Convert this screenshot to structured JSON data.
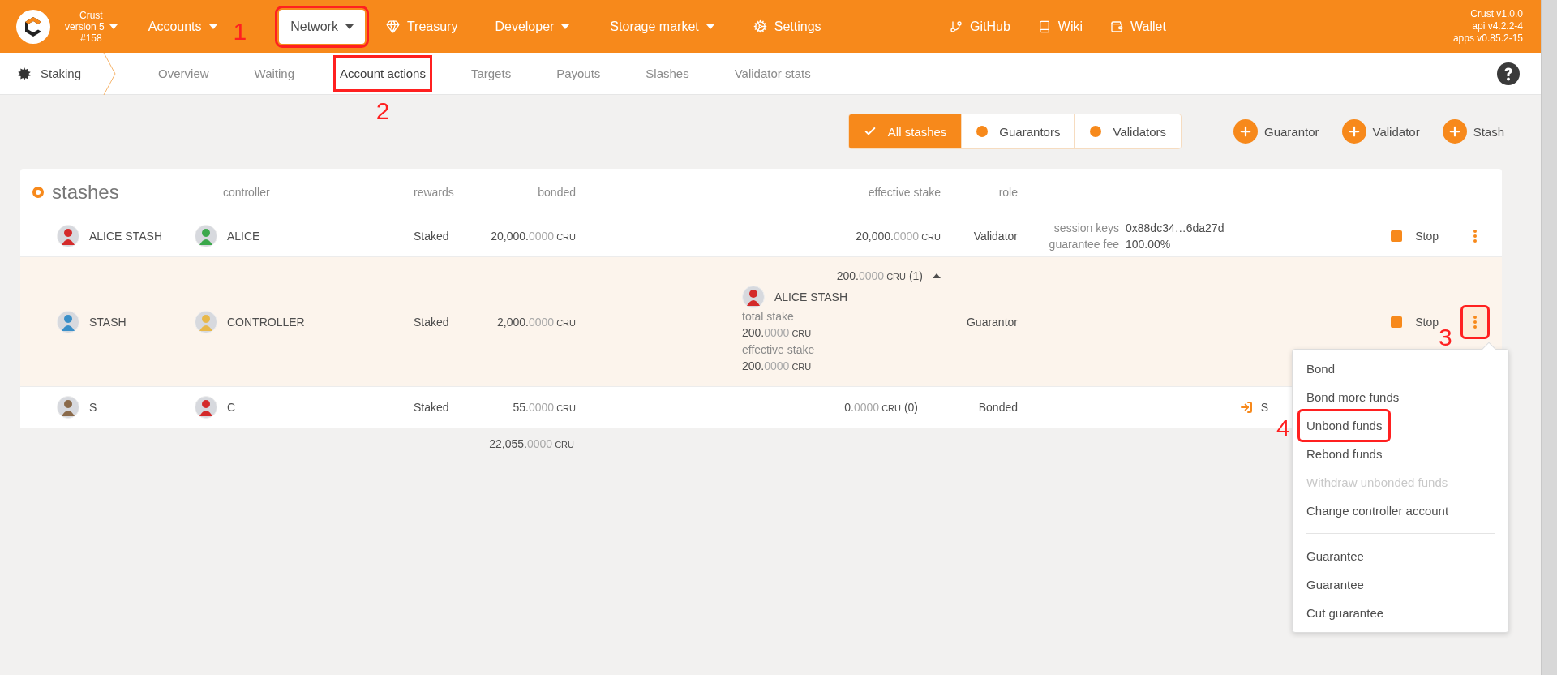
{
  "header": {
    "logo": {
      "name": "Crust",
      "version": "version 5",
      "build": "#158"
    },
    "nav": [
      {
        "label": "Accounts",
        "kind": "menu",
        "selected": false
      },
      {
        "label": "Network",
        "kind": "menu",
        "selected": true,
        "annotation": "1"
      },
      {
        "label": "Treasury",
        "kind": "link",
        "selected": false
      },
      {
        "label": "Developer",
        "kind": "menu",
        "selected": false
      },
      {
        "label": "Storage market",
        "kind": "menu",
        "selected": false
      },
      {
        "label": "Settings",
        "kind": "link",
        "selected": false
      }
    ],
    "links": [
      "GitHub",
      "Wiki",
      "Wallet"
    ],
    "versions": [
      "Crust v1.0.0",
      "api v4.2.2-4",
      "apps v0.85.2-15"
    ]
  },
  "subnav": {
    "section": "Staking",
    "tabs": [
      {
        "label": "Overview",
        "selected": false
      },
      {
        "label": "Waiting",
        "selected": false
      },
      {
        "label": "Account actions",
        "selected": true,
        "annotation": "2"
      },
      {
        "label": "Targets",
        "selected": false
      },
      {
        "label": "Payouts",
        "selected": false
      },
      {
        "label": "Slashes",
        "selected": false
      },
      {
        "label": "Validator stats",
        "selected": false
      }
    ]
  },
  "filters": [
    {
      "label": "All stashes",
      "selected": true
    },
    {
      "label": "Guarantors",
      "selected": false
    },
    {
      "label": "Validators",
      "selected": false
    }
  ],
  "add_buttons": [
    "Guarantor",
    "Validator",
    "Stash"
  ],
  "table": {
    "title": "stashes",
    "columns": [
      "controller",
      "rewards",
      "bonded",
      "effective stake",
      "role"
    ],
    "rows": [
      {
        "stash": {
          "name": "ALICE STASH",
          "color": "#d42a2a"
        },
        "controller": {
          "name": "ALICE",
          "color": "#3aa84a"
        },
        "rewards": "Staked",
        "bonded": {
          "whole": "20,000.",
          "fraction": "0000",
          "unit": "CRU"
        },
        "effective": {
          "amount": {
            "whole": "20,000.",
            "fraction": "0000",
            "unit": "CRU"
          }
        },
        "role": "Validator",
        "details": [
          {
            "label": "session keys",
            "value": "0x88dc34…6da27d"
          },
          {
            "label": "guarantee fee",
            "value": "100.00%"
          }
        ],
        "actions": [
          {
            "kind": "stop",
            "label": "Stop"
          },
          {
            "kind": "more",
            "menu_open": false
          }
        ]
      },
      {
        "stash": {
          "name": "STASH",
          "color": "#3a8fc8"
        },
        "controller": {
          "name": "CONTROLLER",
          "color": "#e8b84a"
        },
        "rewards": "Staked",
        "bonded": {
          "whole": "2,000.",
          "fraction": "0000",
          "unit": "CRU"
        },
        "effective": {
          "amount": {
            "whole": "200.",
            "fraction": "0000",
            "unit": "CRU"
          },
          "count": "(1)",
          "expanded": true,
          "nominees": [
            {
              "name": "ALICE STASH",
              "color": "#d42a2a",
              "total_label": "total stake",
              "total": {
                "whole": "200.",
                "fraction": "0000",
                "unit": "CRU"
              },
              "effective_label": "effective stake",
              "effective": {
                "whole": "200.",
                "fraction": "0000",
                "unit": "CRU"
              }
            }
          ]
        },
        "role": "Guarantor",
        "highlighted": true,
        "actions": [
          {
            "kind": "stop",
            "label": "Stop"
          },
          {
            "kind": "more",
            "menu_open": true,
            "annotation": "3"
          }
        ]
      },
      {
        "stash": {
          "name": "S",
          "color": "#8a6a4a"
        },
        "controller": {
          "name": "C",
          "color": "#d42a2a"
        },
        "rewards": "Staked",
        "bonded": {
          "whole": "55.",
          "fraction": "0000",
          "unit": "CRU"
        },
        "effective": {
          "amount": {
            "whole": "0.",
            "fraction": "0000",
            "unit": "CRU"
          },
          "count": "(0)"
        },
        "role": "Bonded",
        "actions": [
          {
            "kind": "set",
            "label": "S"
          }
        ]
      }
    ],
    "total": {
      "whole": "22,055.",
      "fraction": "0000",
      "unit": "CRU"
    }
  },
  "menu": {
    "groups": [
      [
        {
          "label": "Bond",
          "disabled": false
        },
        {
          "label": "Bond more funds",
          "disabled": false
        },
        {
          "label": "Unbond funds",
          "disabled": false,
          "annotation": "4"
        },
        {
          "label": "Rebond funds",
          "disabled": false
        },
        {
          "label": "Withdraw unbonded funds",
          "disabled": true
        },
        {
          "label": "Change controller account",
          "disabled": false
        }
      ],
      [
        {
          "label": "Guarantee",
          "disabled": false
        },
        {
          "label": "Guarantee",
          "disabled": false
        },
        {
          "label": "Cut guarantee",
          "disabled": false
        }
      ]
    ]
  }
}
